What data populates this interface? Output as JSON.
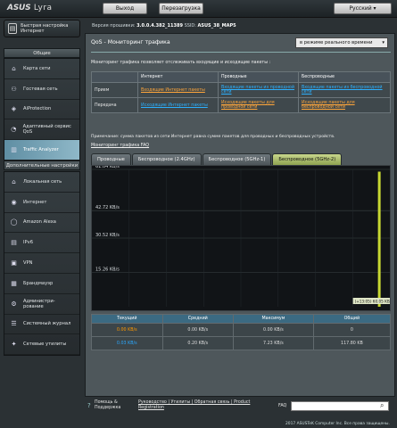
{
  "header": {
    "brand": "ASUS",
    "product": "Lyra",
    "logout": "Выход",
    "reboot": "Перезагрузка",
    "language": "Русский",
    "firmware_label": "Версия прошивки:",
    "firmware": "3.0.0.4.382_11389",
    "ssid_label": "SSID:",
    "ssid": "ASUS_38_MAP5"
  },
  "sidebar": {
    "quick_setup": "Быстрая настройка Интернет",
    "general_title": "Общие",
    "general": [
      {
        "label": "Карта сети",
        "icon": "network-map-icon"
      },
      {
        "label": "Гостевая сеть",
        "icon": "guest-network-icon"
      },
      {
        "label": "AiProtection",
        "icon": "aiprotection-icon"
      },
      {
        "label": "Адаптивный сервис QoS",
        "icon": "qos-icon"
      },
      {
        "label": "Traffic Analyzer",
        "icon": "traffic-analyzer-icon"
      }
    ],
    "advanced_title": "Дополнительные настройки",
    "advanced": [
      {
        "label": "Локальная сеть",
        "icon": "lan-icon"
      },
      {
        "label": "Интернет",
        "icon": "wan-icon"
      },
      {
        "label": "Amazon Alexa",
        "icon": "alexa-icon"
      },
      {
        "label": "IPv6",
        "icon": "ipv6-icon"
      },
      {
        "label": "VPN",
        "icon": "vpn-icon"
      },
      {
        "label": "Брандмауэр",
        "icon": "firewall-icon"
      },
      {
        "label": "Администри-рование",
        "icon": "admin-icon"
      },
      {
        "label": "Системный журнал",
        "icon": "syslog-icon"
      },
      {
        "label": "Сетевые утилиты",
        "icon": "network-tools-icon"
      }
    ]
  },
  "main": {
    "title": "QoS - Мониторинг трафика",
    "mode_select": "в режиме реального времени",
    "description": "Мониторинг трафика позволяет отслеживать входящие и исходящие пакеты :",
    "table": {
      "headers": [
        "",
        "Интернет",
        "Проводные",
        "Беспроводные"
      ],
      "rows": [
        {
          "label": "Прием",
          "internet": "Входящие Интернет пакеты",
          "wired": "Входящие пакеты из проводной сети",
          "wireless": "Входящие пакеты из беспроводной сети"
        },
        {
          "label": "Передача",
          "internet": "Исходящие Интернет пакеты",
          "wired": "Исходящие пакеты для проводной сети",
          "wireless": "Исходящие пакеты для беспроводной сети"
        }
      ]
    },
    "note": "Примечание: сумма пакетов из сети Интернет равна сумме пакетов для проводных и беспроводных устройств.",
    "faq": "Мониторинг трафика FAQ",
    "tabs": [
      "Проводные",
      "Беспроводное (2.4GHz)",
      "Беспроводное (5GHz-1)",
      "Беспроводное (5GHz-2)"
    ],
    "active_tab": 3
  },
  "chart_data": {
    "type": "area",
    "y_labels": [
      "61.04 KB/s",
      "42.72 KB/s",
      "30.52 KB/s",
      "15.26 KB/s"
    ],
    "y_values": [
      61.04,
      42.72,
      30.52,
      15.26
    ],
    "ylim": [
      0,
      61.04
    ],
    "readout": "(+13:05) 60.05 KB/s",
    "series": [
      {
        "name": "Текущий",
        "color": "#ff9900",
        "values": [
          0,
          0,
          0,
          0,
          0,
          0,
          0,
          0,
          0,
          0,
          0,
          0
        ]
      },
      {
        "name": "Прием",
        "color": "#2aa8ff",
        "values": [
          0,
          0,
          0,
          0,
          0,
          0,
          0,
          0,
          0,
          0,
          0,
          0,
          0,
          0,
          0,
          0,
          0,
          0,
          0,
          0,
          0,
          0,
          0,
          0,
          0,
          0,
          0,
          0,
          0,
          0,
          0,
          0,
          0,
          0,
          0,
          0,
          0,
          0,
          0,
          0,
          0,
          0,
          0,
          0,
          0,
          0,
          0,
          0,
          0,
          0,
          0,
          0,
          60.05,
          0,
          0
        ]
      }
    ],
    "bar_color": "#c8d832"
  },
  "stats": {
    "headers": [
      "Текущий",
      "Средний",
      "Максимум",
      "Общий"
    ],
    "rows": [
      {
        "current": "0.00 KB/s",
        "avg": "0.00 KB/s",
        "max": "0.00 KB/s",
        "total": "0",
        "color": "#ff9900"
      },
      {
        "current": "0.03 KB/s",
        "avg": "0.20 KB/s",
        "max": "7.23 KB/s",
        "total": "117.80 KB",
        "color": "#2aa8ff"
      }
    ]
  },
  "footer": {
    "help": "Помощь & Поддержка",
    "links": "Руководство | Утилиты | Обратная связь | Product Registration",
    "faq": "FAQ",
    "copyright": "2017 ASUSTeK Computer Inc. Все права защищены."
  }
}
